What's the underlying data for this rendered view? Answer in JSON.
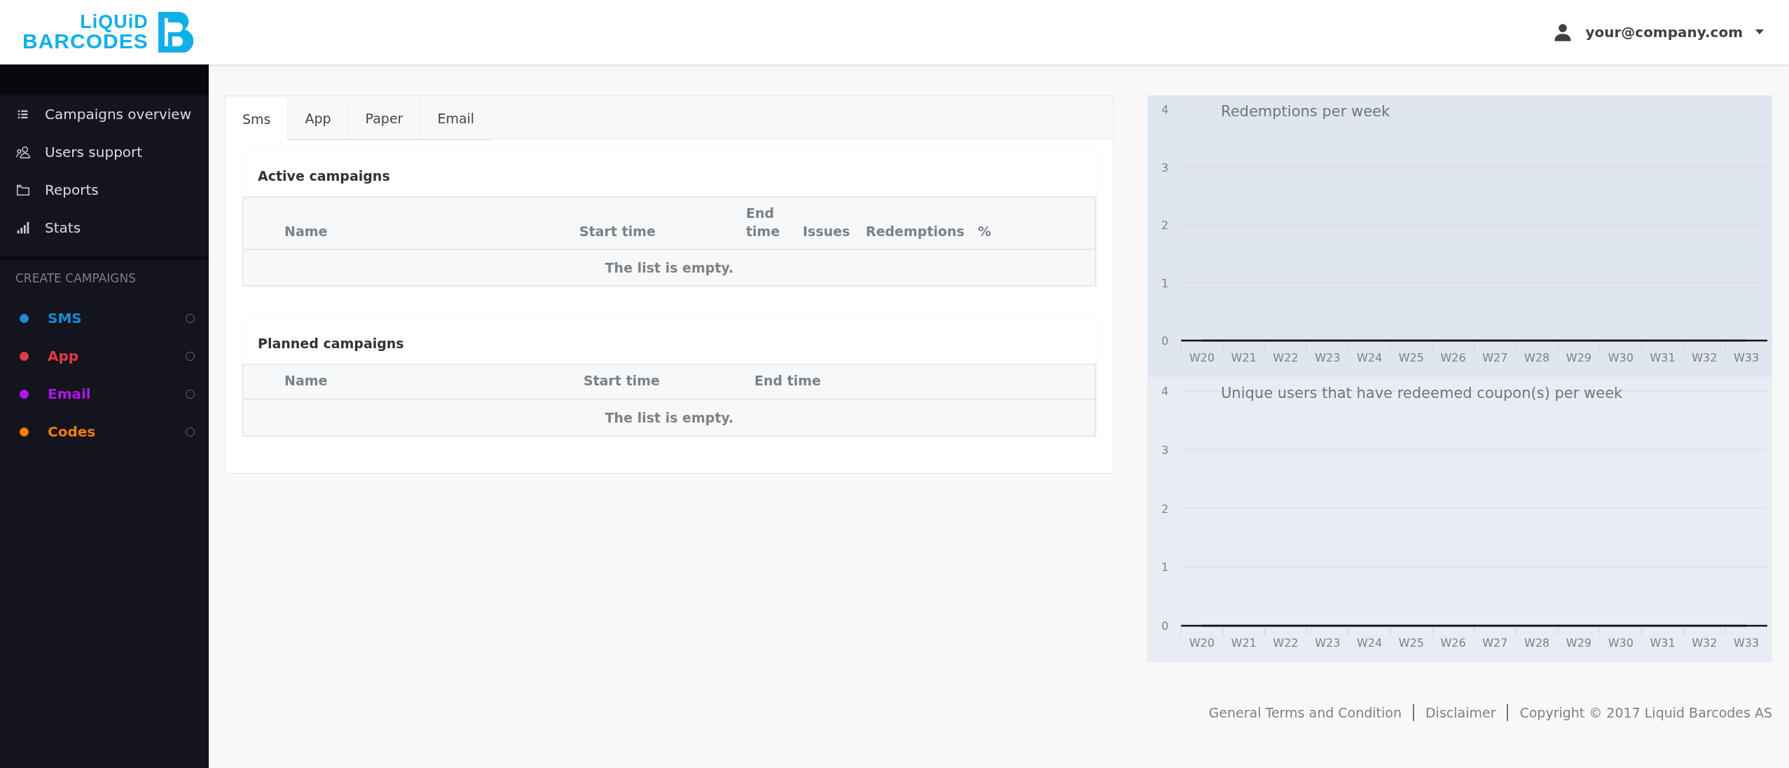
{
  "logo": {
    "line_1": "LiQUiD",
    "line_2": "BARCODES"
  },
  "user_menu": {
    "email": "your@company.com"
  },
  "sidebar": {
    "items": [
      {
        "label": "Campaigns overview",
        "selected": false
      },
      {
        "label": "Users support",
        "selected": false
      },
      {
        "label": "Reports",
        "selected": false
      },
      {
        "label": "Stats",
        "selected": false
      }
    ],
    "section_title": "CREATE CAMPAIGNS",
    "create_items": [
      {
        "label": "SMS",
        "color": "#1e88d8",
        "checked": false
      },
      {
        "label": "App",
        "color": "#e23a4a",
        "checked": false
      },
      {
        "label": "Email",
        "color": "#b314f0",
        "checked": false
      },
      {
        "label": "Codes",
        "color": "#f27c0c",
        "checked": false
      }
    ]
  },
  "tabs": [
    {
      "label": "Sms",
      "selected": true
    },
    {
      "label": "App",
      "selected": false
    },
    {
      "label": "Paper",
      "selected": false
    },
    {
      "label": "Email",
      "selected": false
    }
  ],
  "sections": [
    {
      "title": "Active campaigns",
      "columns": [
        "Name",
        "Start time",
        "End time",
        "Issues",
        "Redemptions",
        "%"
      ],
      "empty_text": "The list is empty."
    },
    {
      "title": "Planned campaigns",
      "columns": [
        "Name",
        "Start time",
        "End time"
      ],
      "empty_text": "The list is empty."
    }
  ],
  "charts": [
    {
      "chart_data": {
        "type": "line",
        "title": "Redemptions per week",
        "categories": [
          "W20",
          "W21",
          "W22",
          "W23",
          "W24",
          "W25",
          "W26",
          "W27",
          "W28",
          "W29",
          "W30",
          "W31",
          "W32",
          "W33"
        ],
        "values": [
          0,
          0,
          0,
          0,
          0,
          0,
          0,
          0,
          0,
          0,
          0,
          0,
          0,
          0
        ],
        "ylim": [
          0,
          4
        ],
        "yticks": [
          0,
          1,
          2,
          3,
          4
        ],
        "grid": true
      }
    },
    {
      "chart_data": {
        "type": "line",
        "title": "Unique users that have redeemed coupon(s) per week",
        "categories": [
          "W20",
          "W21",
          "W22",
          "W23",
          "W24",
          "W25",
          "W26",
          "W27",
          "W28",
          "W29",
          "W30",
          "W31",
          "W32",
          "W33"
        ],
        "values": [
          0,
          0,
          0,
          0,
          0,
          0,
          0,
          0,
          0,
          0,
          0,
          0,
          0,
          0
        ],
        "ylim": [
          0,
          4
        ],
        "yticks": [
          0,
          1,
          2,
          3,
          4
        ],
        "grid": true
      }
    }
  ],
  "footer": {
    "links": [
      "General Terms and Condition",
      "Disclaimer"
    ],
    "copyright": "Copyright © 2017 Liquid Barcodes AS"
  }
}
